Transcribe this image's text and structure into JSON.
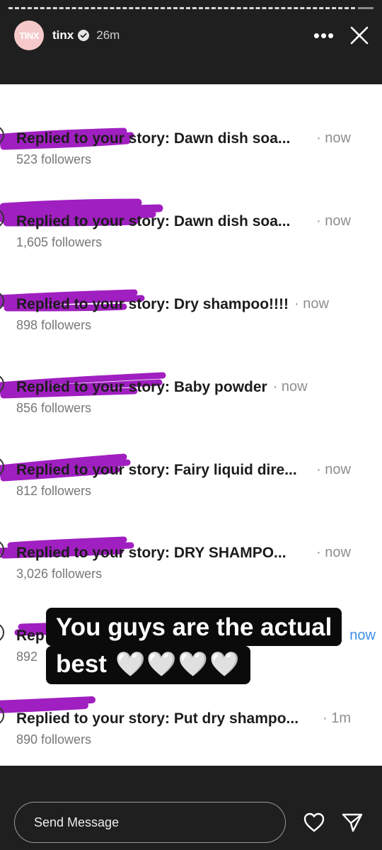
{
  "header": {
    "avatar_text": "TINX",
    "username": "tinx",
    "time": "26m",
    "more_label": "•••"
  },
  "notifications": [
    {
      "message": "Replied to your story: Dawn dish soa...",
      "time": "· now",
      "followers": "523 followers"
    },
    {
      "message": "Replied to your story: Dawn dish soa...",
      "time": "· now",
      "followers": "1,605 followers"
    },
    {
      "message": "Replied to your story: Dry shampoo!!!!",
      "time": "· now",
      "followers": "898 followers"
    },
    {
      "message": "Replied to your story: Baby powder",
      "time": "· now",
      "followers": "856 followers"
    },
    {
      "message": "Replied to your story: Fairy liquid dire...",
      "time": "· now",
      "followers": "812 followers"
    },
    {
      "message": "Replied to your story: DRY SHAMPO...",
      "time": "· now",
      "followers": "3,026 followers"
    },
    {
      "message": "Rep",
      "time": "now",
      "followers": "892"
    },
    {
      "message": "Replied to your story: Put dry shampo...",
      "time": "· 1m",
      "followers": "890 followers"
    }
  ],
  "caption": {
    "line1": "You guys are the actual",
    "line2": "best",
    "hearts": "🤍🤍🤍🤍"
  },
  "footer": {
    "placeholder": "Send Message"
  },
  "colors": {
    "redaction": "#a01fc0",
    "background": "#1f1f1f",
    "story_bg": "#ffffff"
  },
  "icons": {
    "verified": "verified-badge-icon",
    "close": "close-icon",
    "like": "heart-icon",
    "share": "paper-plane-icon"
  }
}
